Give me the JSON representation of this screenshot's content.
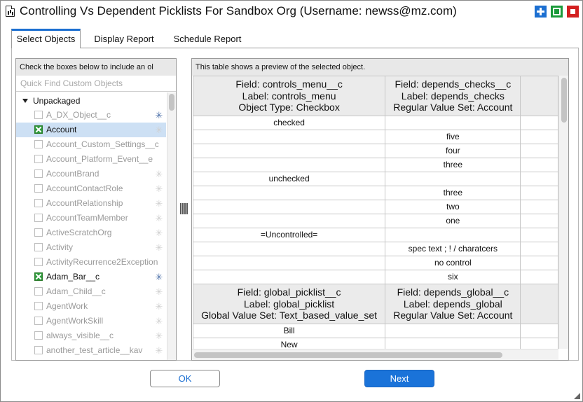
{
  "window": {
    "title": "Controlling Vs Dependent Picklists For Sandbox Org (Username: newss@mz.com)",
    "buttons": {
      "plus_color": "#1c6fd1",
      "maximize_color": "#1a9a3a",
      "close_color": "#d32020"
    }
  },
  "tabs": [
    {
      "label": "Select Objects",
      "active": true
    },
    {
      "label": "Display Report",
      "active": false
    },
    {
      "label": "Schedule Report",
      "active": false
    }
  ],
  "left_panel": {
    "header": "Check the boxes below to include an ol",
    "quick_find_placeholder": "Quick Find Custom Objects",
    "group": "Unpackaged",
    "items": [
      {
        "label": "A_DX_Object__c",
        "checked": false,
        "selected": false,
        "icon": "blue-star-icon"
      },
      {
        "label": "Account",
        "checked": true,
        "selected": true,
        "icon": "gray-star-icon"
      },
      {
        "label": "Account_Custom_Settings__c",
        "checked": false,
        "selected": false,
        "icon": ""
      },
      {
        "label": "Account_Platform_Event__e",
        "checked": false,
        "selected": false,
        "icon": ""
      },
      {
        "label": "AccountBrand",
        "checked": false,
        "selected": false,
        "icon": "gray-star-icon"
      },
      {
        "label": "AccountContactRole",
        "checked": false,
        "selected": false,
        "icon": "gray-star-icon"
      },
      {
        "label": "AccountRelationship",
        "checked": false,
        "selected": false,
        "icon": "gray-star-icon"
      },
      {
        "label": "AccountTeamMember",
        "checked": false,
        "selected": false,
        "icon": "gray-star-icon"
      },
      {
        "label": "ActiveScratchOrg",
        "checked": false,
        "selected": false,
        "icon": "gray-star-icon"
      },
      {
        "label": "Activity",
        "checked": false,
        "selected": false,
        "icon": "gray-star-icon"
      },
      {
        "label": "ActivityRecurrence2Exception",
        "checked": false,
        "selected": false,
        "icon": ""
      },
      {
        "label": "Adam_Bar__c",
        "checked": true,
        "selected": false,
        "icon": "blue-star-icon"
      },
      {
        "label": "Adam_Child__c",
        "checked": false,
        "selected": false,
        "icon": "gray-star-icon"
      },
      {
        "label": "AgentWork",
        "checked": false,
        "selected": false,
        "icon": "gray-star-icon"
      },
      {
        "label": "AgentWorkSkill",
        "checked": false,
        "selected": false,
        "icon": "gray-star-icon"
      },
      {
        "label": "always_visible__c",
        "checked": false,
        "selected": false,
        "icon": "gray-star-icon"
      },
      {
        "label": "another_test_article__kav",
        "checked": false,
        "selected": false,
        "icon": "gray-star-icon"
      }
    ]
  },
  "right_panel": {
    "header": "This table shows a preview of the selected object.",
    "table1": {
      "controlling_header": [
        "Field: controls_menu__c",
        "Label: controls_menu",
        "Object Type: Checkbox"
      ],
      "dependent_header": [
        "Field: depends_checks__c",
        "Label: depends_checks",
        "Regular Value Set: Account"
      ],
      "rows": [
        [
          "checked",
          ""
        ],
        [
          "",
          "five"
        ],
        [
          "",
          "four"
        ],
        [
          "",
          "three"
        ],
        [
          "unchecked",
          ""
        ],
        [
          "",
          "three"
        ],
        [
          "",
          "two"
        ],
        [
          "",
          "one"
        ],
        [
          "=Uncontrolled=",
          ""
        ],
        [
          "",
          "spec text ; ! /  charatcers"
        ],
        [
          "",
          "no control"
        ],
        [
          "",
          "six"
        ]
      ]
    },
    "table2": {
      "controlling_header": [
        "Field: global_picklist__c",
        "Label: global_picklist",
        "Global Value Set: Text_based_value_set"
      ],
      "dependent_header": [
        "Field: depends_global__c",
        "Label: depends_global",
        "Regular Value Set: Account"
      ],
      "rows": [
        [
          "Bill",
          ""
        ],
        [
          "New",
          ""
        ]
      ]
    }
  },
  "footer": {
    "ok_label": "OK",
    "next_label": "Next",
    "next_color": "#1a73d9"
  }
}
